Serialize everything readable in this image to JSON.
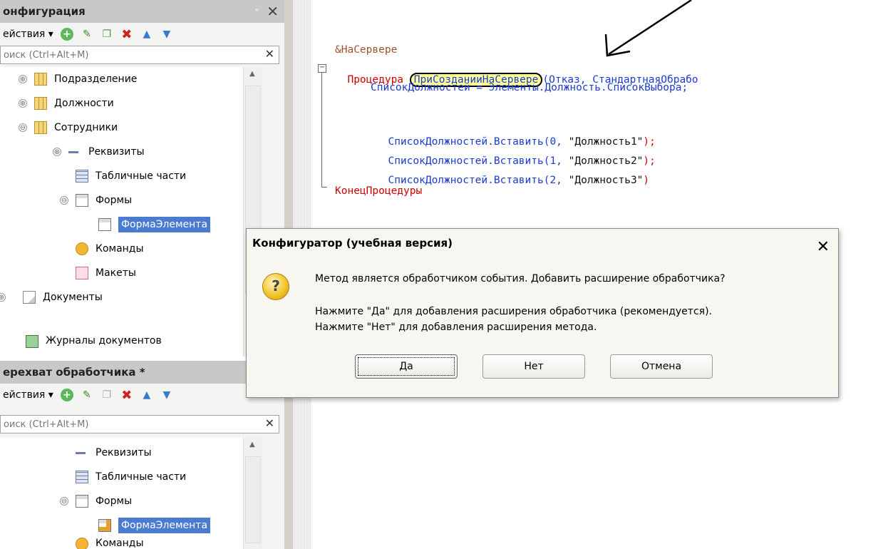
{
  "config_panel": {
    "title": "онфигурация",
    "actions_label": "ействия ▾",
    "search_placeholder": "оиск (Ctrl+Alt+M)",
    "tree": [
      {
        "label": "Подразделение",
        "icon": "catalog-icon",
        "expander": "⊕"
      },
      {
        "label": "Должности",
        "icon": "catalog-icon",
        "expander": "⊕"
      },
      {
        "label": "Сотрудники",
        "icon": "catalog-icon",
        "expander": "⊖"
      },
      {
        "label": "Реквизиты",
        "icon": "attributes-icon",
        "expander": "⊕"
      },
      {
        "label": "Табличные части",
        "icon": "table-parts-icon",
        "expander": ""
      },
      {
        "label": "Формы",
        "icon": "forms-icon",
        "expander": "⊖"
      },
      {
        "label": "ФормаЭлемента",
        "icon": "form-icon",
        "expander": ""
      },
      {
        "label": "Команды",
        "icon": "commands-icon",
        "expander": ""
      },
      {
        "label": "Макеты",
        "icon": "layouts-icon",
        "expander": ""
      },
      {
        "label": "Документы",
        "icon": "documents-icon",
        "expander": "⊕"
      },
      {
        "label": "Журналы документов",
        "icon": "journals-icon",
        "expander": ""
      }
    ]
  },
  "handler_panel": {
    "title": "ерехват обработчика *",
    "actions_label": "ействия ▾",
    "search_placeholder": "оиск (Ctrl+Alt+M)",
    "tree": [
      {
        "label": "Реквизиты",
        "icon": "attributes-icon",
        "expander": ""
      },
      {
        "label": "Табличные части",
        "icon": "table-parts-icon",
        "expander": ""
      },
      {
        "label": "Формы",
        "icon": "forms-icon",
        "expander": "⊖"
      },
      {
        "label": "ФормаЭлемента",
        "icon": "form-icon",
        "expander": ""
      },
      {
        "label": "Команды",
        "icon": "commands-icon",
        "expander": ""
      }
    ]
  },
  "code": {
    "directive": "&НаСервере",
    "proc_kw": "Процедура",
    "proc_name": "ПриСозданииНаСервере",
    "proc_params": "(Отказ, СтандартнаяОбрабо",
    "line2": "СписокДолжностей = Элементы.Должность.СписокВыбора;",
    "insert1_a": "СписокДолжностей.Вставить(0, ",
    "insert1_b": "\"Должность1\"",
    "insert1_c": ");",
    "insert2_a": "СписокДолжностей.Вставить(1, ",
    "insert2_b": "\"Должность2\"",
    "insert2_c": ");",
    "insert3_a": "СписокДолжностей.Вставить(2, ",
    "insert3_b": "\"Должность3\"",
    "insert3_c": ")",
    "end_kw": "КонецПроцедуры"
  },
  "dialog": {
    "title": "Конфигуратор (учебная версия)",
    "question": "Метод является обработчиком события. Добавить расширение обработчика?",
    "hint_yes": "Нажмите \"Да\" для добавления расширения обработчика (рекомендуется).",
    "hint_no": "Нажмите \"Нет\" для добавления расширения метода.",
    "yes_label": "Да",
    "no_label": "Нет",
    "cancel_label": "Отмена",
    "close_glyph": "✕",
    "question_glyph": "?"
  }
}
